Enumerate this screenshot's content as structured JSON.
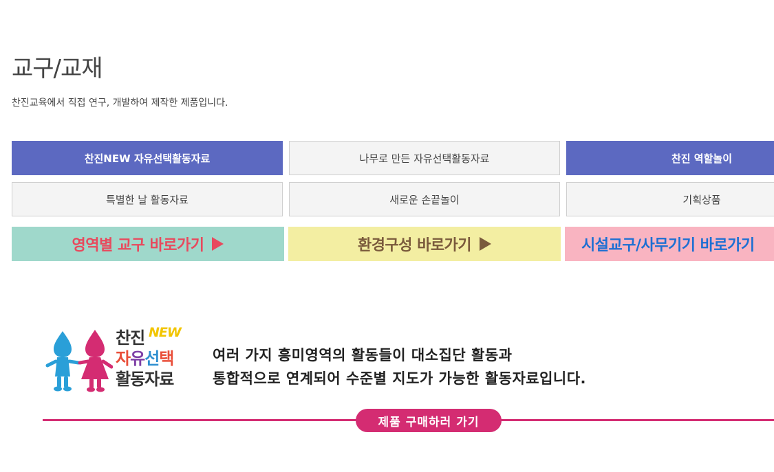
{
  "header": {
    "title": "교구/교재",
    "description": "찬진교육에서 직접 연구, 개발하여 제작한 제품입니다."
  },
  "category_tabs": [
    {
      "label": "찬진NEW 자유선택활동자료",
      "active": true
    },
    {
      "label": "나무로 만든 자유선택활동자료",
      "active": false
    },
    {
      "label": "찬진 역할놀이",
      "active": true
    },
    {
      "label": "특별한 날 활동자료",
      "active": false
    },
    {
      "label": "새로운 손끝놀이",
      "active": false
    },
    {
      "label": "기획상품",
      "active": false
    }
  ],
  "shortcuts": [
    {
      "label": "영역별 교구 바로가기",
      "color": "#e8495d",
      "bg": "#9fd8cb"
    },
    {
      "label": "환경구성 바로가기",
      "color": "#7a5a3c",
      "bg": "#f3eea2"
    },
    {
      "label": "시설교구/사무기기 바로가기",
      "color": "#1c6fd3",
      "bg": "#f9b4c1"
    }
  ],
  "feature": {
    "logo": {
      "line1": "찬진",
      "badge": "NEW",
      "line2": [
        "자",
        "유",
        "선",
        "택"
      ],
      "line3": "활동자료"
    },
    "description_lines": [
      "여러 가지 흥미영역의 활동들이 대소집단 활동과",
      "통합적으로 연계되어 수준별 지도가 가능한 활동자료입니다."
    ],
    "buy_button": "제품 구매하러 가기"
  },
  "colors": {
    "active_tab": "#5c69c1",
    "accent_pink": "#d42c72"
  }
}
